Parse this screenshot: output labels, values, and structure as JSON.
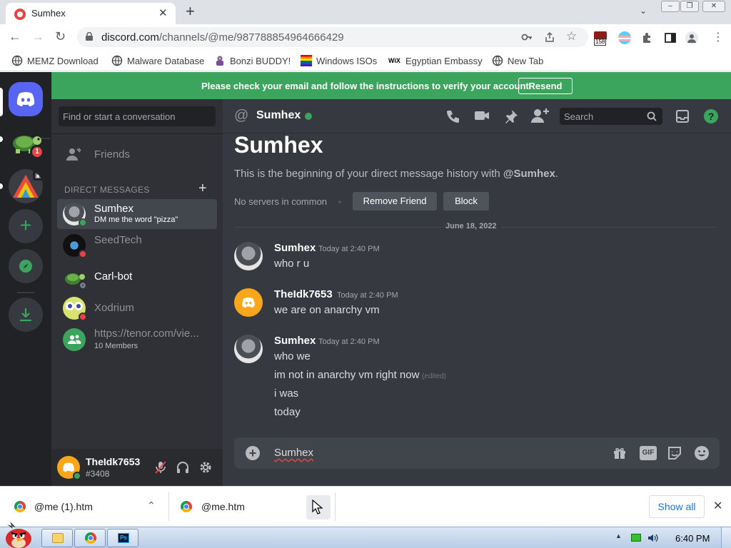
{
  "browser": {
    "tab": {
      "title": "Sumhex",
      "close": "✕"
    },
    "new_tab": "+",
    "url_host": "discord.com",
    "url_path": "/channels/@me/987788854964666429",
    "extension_badge": "158",
    "bookmarks": [
      {
        "label": "MEMZ Download",
        "icon": "globe-icon"
      },
      {
        "label": "Malware Database",
        "icon": "globe-icon"
      },
      {
        "label": "Bonzi BUDDY!",
        "icon": "bonzi-icon"
      },
      {
        "label": "Windows ISOs",
        "icon": "rainbow-flag-icon"
      },
      {
        "label": "Egyptian Embassy",
        "icon": "wix-icon"
      },
      {
        "label": "New Tab",
        "icon": "globe-icon"
      }
    ]
  },
  "discord": {
    "banner": {
      "message": "Please check your email and follow the instructions to verify your account.",
      "button": "Resend"
    },
    "guild_badge": "1",
    "dm_list": {
      "search_placeholder": "Find or start a conversation",
      "friends_label": "Friends",
      "section_header": "DIRECT MESSAGES",
      "section_add": "+",
      "items": [
        {
          "name": "Sumhex",
          "status_text": "DM me the word \"pizza\"",
          "status": "online"
        },
        {
          "name": "SeedTech",
          "status_text": "",
          "status": "dnd"
        },
        {
          "name": "Carl-bot",
          "status_text": "",
          "status": "offline"
        },
        {
          "name": "Xodrium",
          "status_text": "",
          "status": "dnd"
        },
        {
          "name": "https://tenor.com/vie...",
          "status_text": "10 Members",
          "status": "group"
        }
      ]
    },
    "user_panel": {
      "username": "TheIdk7653",
      "discriminator": "#3408"
    },
    "header": {
      "channel_name": "Sumhex",
      "search_placeholder": "Search"
    },
    "intro": {
      "title": "Sumhex",
      "text_prefix": "This is the beginning of your direct message history with ",
      "text_user": "@Sumhex",
      "text_suffix": ".",
      "no_servers": "No servers in common",
      "remove_friend": "Remove Friend",
      "block": "Block"
    },
    "date_divider": "June 18, 2022",
    "messages": [
      {
        "author": "Sumhex",
        "time": "Today at 2:40 PM",
        "lines": [
          {
            "text": "who r u",
            "edited": ""
          }
        ]
      },
      {
        "author": "TheIdk7653",
        "time": "Today at 2:40 PM",
        "lines": [
          {
            "text": "we are on anarchy vm",
            "edited": ""
          }
        ]
      },
      {
        "author": "Sumhex",
        "time": "Today at 2:40 PM",
        "lines": [
          {
            "text": "who we",
            "edited": ""
          },
          {
            "text": "im not in anarchy vm right now",
            "edited": "(edited)"
          },
          {
            "text": "i was",
            "edited": ""
          },
          {
            "text": "today",
            "edited": ""
          }
        ]
      }
    ],
    "composer": {
      "value": "Sumhex",
      "gif_label": "GIF"
    },
    "colors": {
      "online": "#3ba55d",
      "dnd": "#ed4245",
      "offline": "#747f8d",
      "blurple": "#5865f2",
      "banner": "#3ba55d"
    }
  },
  "downloads": {
    "items": [
      {
        "name": "@me (1).htm"
      },
      {
        "name": "@me.htm"
      }
    ],
    "show_all": "Show all",
    "close": "✕"
  },
  "taskbar": {
    "clock": "6:40 PM"
  }
}
